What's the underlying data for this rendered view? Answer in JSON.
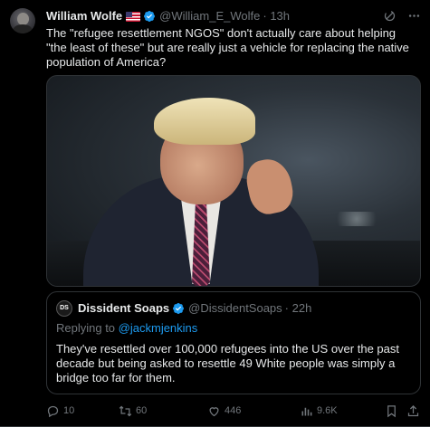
{
  "tweet": {
    "author_name": "William Wolfe",
    "author_handle": "@William_E_Wolfe",
    "time": "· 13h",
    "text": "The \"refugee resettlement NGOS\" don't actually care about helping \"the least of these\" but are really just a vehicle for replacing the native population of America?",
    "icons": {
      "flag": "us-flag-icon",
      "verified": "verified-badge-icon",
      "grok": "grok-icon",
      "more": "more-icon"
    }
  },
  "quote": {
    "avatar_text": "DS",
    "author_name": "Dissident Soaps",
    "author_handle": "@DissidentSoaps",
    "time": "· 22h",
    "reply_prefix": "Replying to",
    "reply_handle": "@jackmjenkins",
    "text": "They've resettled over 100,000 refugees into the US over the past decade but being asked to resettle 49 White people was simply a bridge too far for them."
  },
  "actions": {
    "replies": "10",
    "reposts": "60",
    "likes": "446",
    "views": "9.6K"
  },
  "colors": {
    "accent": "#1d9bf0",
    "muted": "#71767b",
    "text": "#e7e9ea",
    "border": "#2f3336"
  }
}
